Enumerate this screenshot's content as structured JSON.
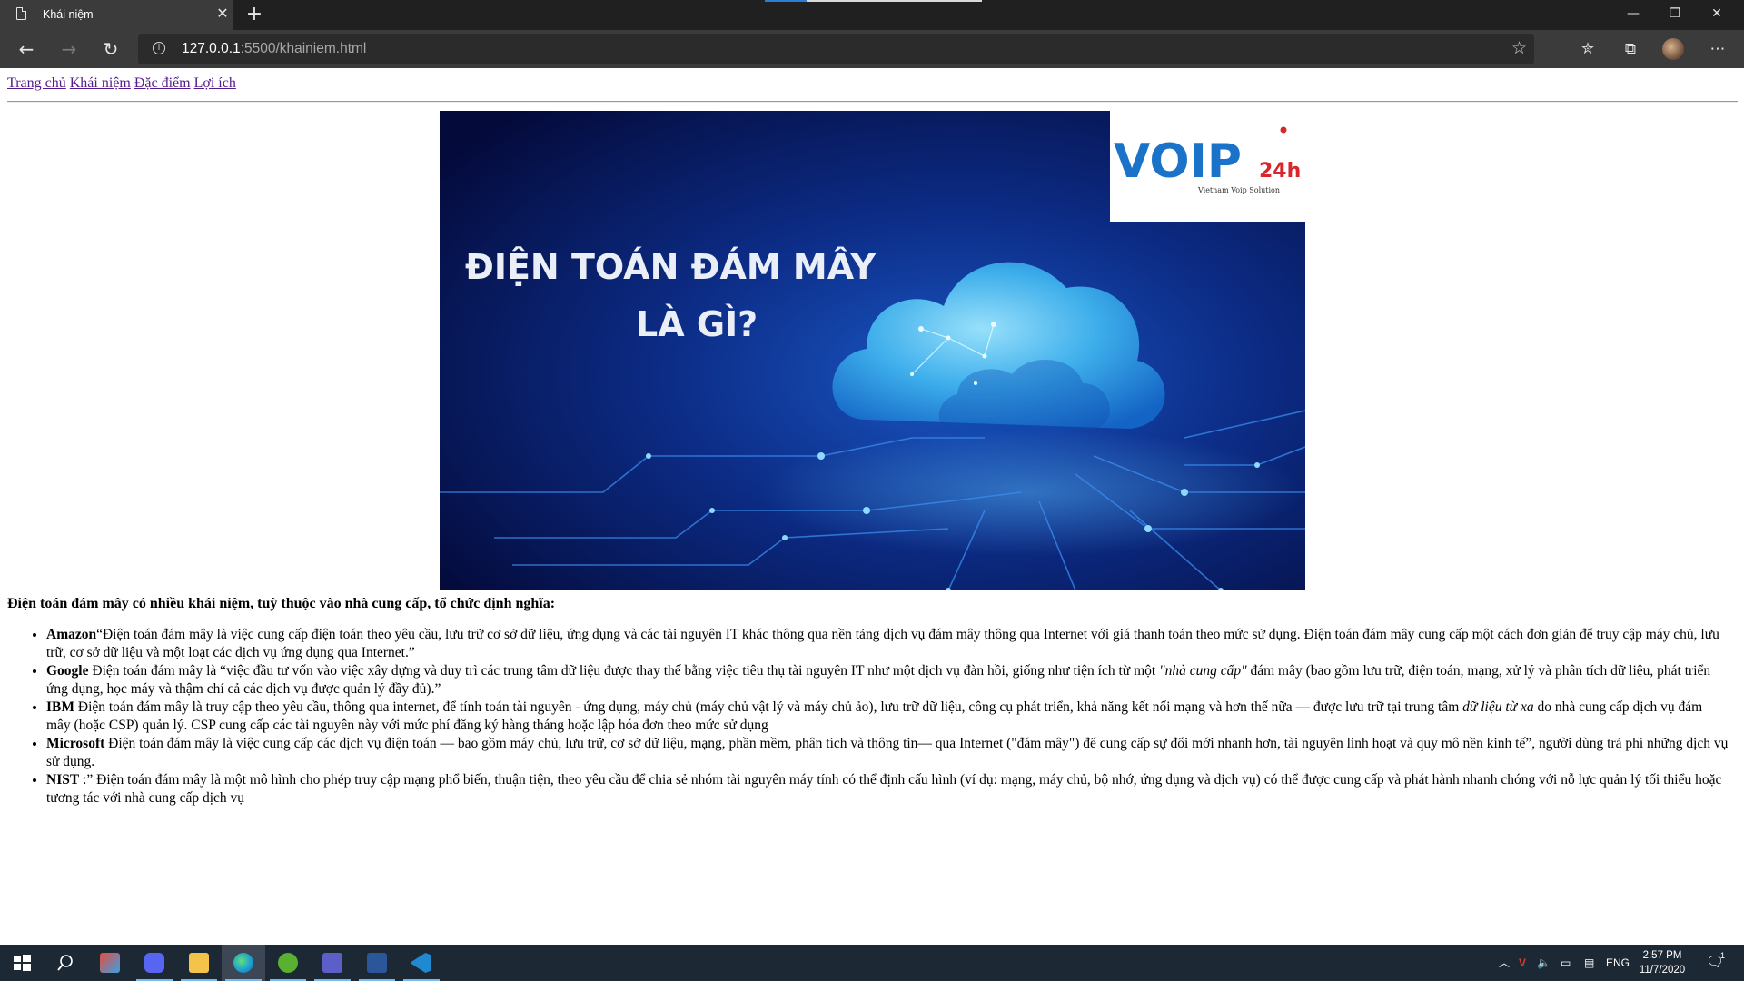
{
  "browser": {
    "tab_title": "Khái niệm",
    "close_tab_glyph": "✕",
    "new_tab_glyph": "+",
    "url_host": "127.0.0.1",
    "url_rest": ":5500/khainiem.html",
    "window_controls": {
      "minimize": "—",
      "restore": "❐",
      "close": "✕"
    }
  },
  "nav": {
    "home": "Trang chủ",
    "concept": "Khái niệm",
    "features": "Đặc điểm",
    "benefits": "Lợi ích"
  },
  "hero": {
    "logo_main": "VOIP",
    "logo_suffix": "24h",
    "logo_tagline": "Vietnam Voip Solution",
    "line1": "ĐIỆN TOÁN ĐÁM MÂY",
    "line2": "LÀ GÌ?"
  },
  "content": {
    "intro": "Điện toán đám mây có nhiều khái niệm, tuỳ thuộc vào nhà cung cấp, tổ chức định nghĩa:",
    "definitions": [
      {
        "org": "Amazon",
        "text": "“Điện toán đám mây là việc cung cấp điện toán theo yêu cầu, lưu trữ cơ sở dữ liệu, ứng dụng và các tài nguyên IT khác thông qua nền tảng dịch vụ đám mây thông qua Internet với giá thanh toán theo mức sử dụng. Điện toán đám mây cung cấp một cách đơn giản để truy cập máy chủ, lưu trữ, cơ sở dữ liệu và một loạt các dịch vụ ứng dụng qua Internet.”"
      },
      {
        "org": "Google",
        "text_a": " Điện toán đám mây là “việc đầu tư vốn vào việc xây dựng và duy trì các trung tâm dữ liệu được thay thế bằng việc tiêu thụ tài nguyên IT như một dịch vụ đàn hồi, giống như tiện ích từ một ",
        "em": "\"nhà cung cấp\"",
        "text_b": " đám mây (bao gồm lưu trữ, điện toán, mạng, xử lý và phân tích dữ liệu, phát triển ứng dụng, học máy và thậm chí cả các dịch vụ được quản lý đầy đủ).”"
      },
      {
        "org": "IBM",
        "text_a": " Điện toán đám mây là truy cập theo yêu cầu, thông qua internet, để tính toán tài nguyên - ứng dụng, máy chủ (máy chủ vật lý và máy chủ ảo), lưu trữ dữ liệu, công cụ phát triển, khả năng kết nối mạng và hơn thế nữa — được lưu trữ tại trung tâm ",
        "em": "dữ liệu từ xa",
        "text_b": " do nhà cung cấp dịch vụ đám mây (hoặc CSP) quản lý. CSP cung cấp các tài nguyên này với mức phí đăng ký hàng tháng hoặc lập hóa đơn theo mức sử dụng"
      },
      {
        "org": "Microsoft",
        "text": " Điện toán đám mây là việc cung cấp các dịch vụ điện toán — bao gồm máy chủ, lưu trữ, cơ sở dữ liệu, mạng, phần mềm, phân tích và thông tin— qua Internet (\"đám mây\") để cung cấp sự đổi mới nhanh hơn, tài nguyên linh hoạt và quy mô nền kinh tế”, người dùng trả phí những dịch vụ sử dụng."
      },
      {
        "org": "NIST",
        "text": " :” Điện toán đám mây là một mô hình cho phép truy cập mạng phổ biến, thuận tiện, theo yêu cầu để chia sẻ nhóm tài nguyên máy tính có thể định cấu hình (ví dụ: mạng, máy chủ, bộ nhớ, ứng dụng và dịch vụ) có thể được cung cấp và phát hành nhanh chóng với nỗ lực quản lý tối thiểu hoặc tương tác với nhà cung cấp dịch vụ"
      }
    ]
  },
  "taskbar": {
    "language": "ENG",
    "time": "2:57 PM",
    "date": "11/7/2020",
    "notification_count": "1"
  },
  "colors": {
    "link": "#551a8b",
    "accent": "#2b7dd6",
    "taskbar": "#1d2835"
  }
}
